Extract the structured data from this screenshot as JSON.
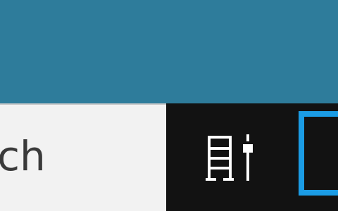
{
  "desktop": {
    "background_color": "#2E7C9B"
  },
  "taskbar": {
    "background_color": "#121212",
    "search": {
      "placeholder": "arch"
    },
    "task_view": {
      "icon": "task-view-icon"
    },
    "app_button": {
      "accent_color": "#1B9CE5",
      "state": "active"
    }
  }
}
